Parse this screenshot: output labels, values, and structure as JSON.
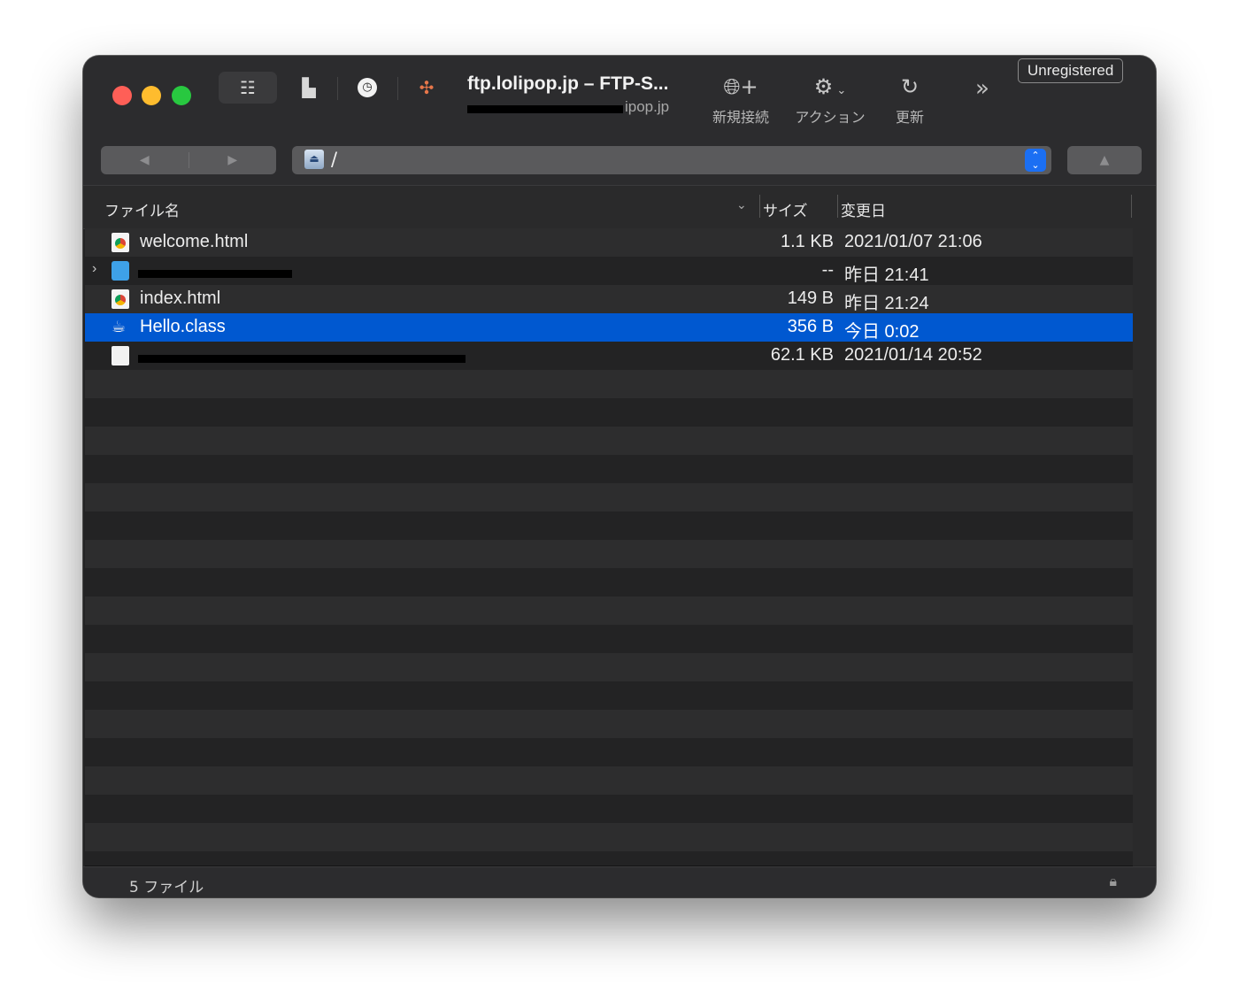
{
  "window": {
    "title": "ftp.lolipop.jp – FTP-S...",
    "subtitle": "ipop.jp"
  },
  "toolbar": {
    "unregistered": "Unregistered",
    "new_connection_label": "新規接続",
    "action_label": "アクション",
    "refresh_label": "更新",
    "more_label": "»"
  },
  "pathbar": {
    "path": "/"
  },
  "columns": {
    "name": "ファイル名",
    "size": "サイズ",
    "modified": "変更日"
  },
  "files": [
    {
      "name": "welcome.html",
      "size": "1.1 KB",
      "modified": "2021/01/07 21:06",
      "icon": "html-file-icon"
    },
    {
      "name": "",
      "size": "--",
      "modified": "昨日 21:41",
      "icon": "folder-icon"
    },
    {
      "name": "index.html",
      "size": "149 B",
      "modified": "昨日 21:24",
      "icon": "html-file-icon"
    },
    {
      "name": "Hello.class",
      "size": "356 B",
      "modified": "今日 0:02",
      "icon": "java-class-icon",
      "selected": true
    },
    {
      "name": "",
      "size": "62.1 KB",
      "modified": "2021/01/14 20:52",
      "icon": "document-icon"
    }
  ],
  "status": {
    "count": "5 ファイル"
  },
  "colors": {
    "selection": "#0058d0",
    "window_bg": "#232324",
    "accent": "#1b6ff3"
  }
}
